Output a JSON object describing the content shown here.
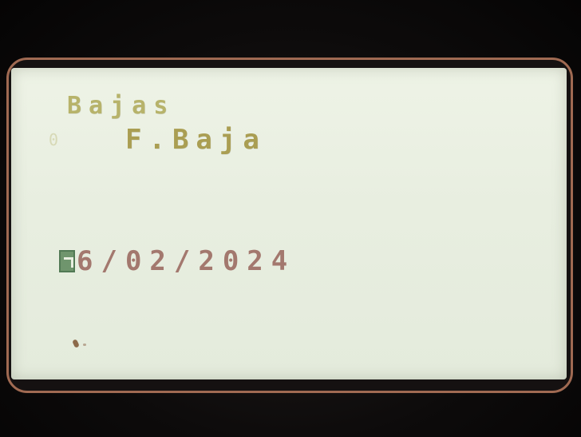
{
  "screen": {
    "title": "Bajas",
    "row_index": "0",
    "field_label": "F.Baja",
    "date_value": "6/02/2024"
  },
  "device": {
    "logo_left": "",
    "logo_right": ""
  },
  "colors": {
    "lcd_background": "#e8eee0",
    "title_text": "#b7b36a",
    "field_label_text": "#aa9e52",
    "date_text": "#a3786e",
    "cursor_block": "#6f956d",
    "bezel_rim": "#a06a52"
  },
  "icons": {
    "cursor": "cursor-block-icon"
  }
}
